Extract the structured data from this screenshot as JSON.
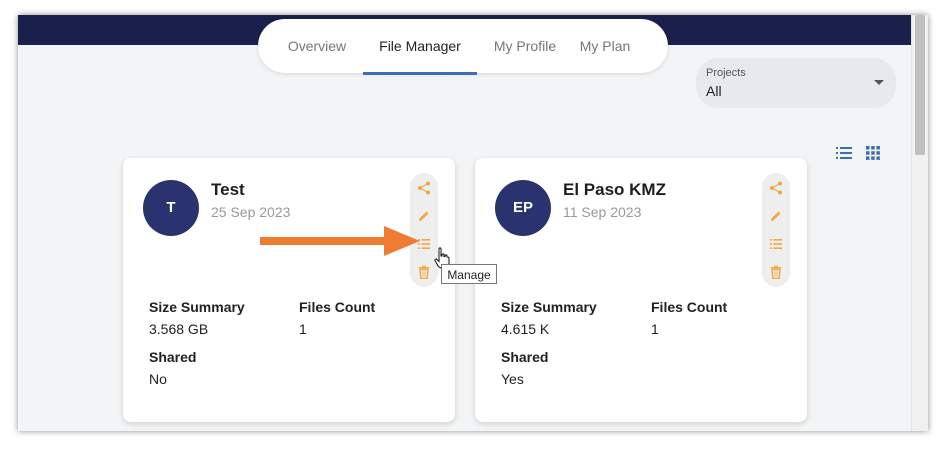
{
  "nav": {
    "tabs": [
      {
        "label": "Overview"
      },
      {
        "label": "File Manager"
      },
      {
        "label": "My Profile"
      },
      {
        "label": "My Plan"
      }
    ]
  },
  "filter": {
    "label": "Projects",
    "value": "All"
  },
  "cards": [
    {
      "initials": "T",
      "title": "Test",
      "date": "25 Sep 2023",
      "size_label": "Size Summary",
      "size_value": "3.568 GB",
      "count_label": "Files Count",
      "count_value": "1",
      "shared_label": "Shared",
      "shared_value": "No"
    },
    {
      "initials": "EP",
      "title": "El Paso KMZ",
      "date": "11 Sep 2023",
      "size_label": "Size Summary",
      "size_value": "4.615 K",
      "count_label": "Files Count",
      "count_value": "1",
      "shared_label": "Shared",
      "shared_value": "Yes"
    }
  ],
  "tooltip": {
    "text": "Manage"
  },
  "colors": {
    "topbar": "#1b1f4b",
    "accent_tab": "#3b6fb5",
    "avatar": "#2a3270",
    "action_icon": "#f4a640",
    "callout_arrow": "#ee7d31",
    "view_icon": "#3b6fb5"
  },
  "icons": {
    "actions": [
      "share-icon",
      "edit-icon",
      "manage-icon",
      "delete-icon"
    ],
    "views": [
      "list-view-icon",
      "grid-view-icon"
    ]
  }
}
